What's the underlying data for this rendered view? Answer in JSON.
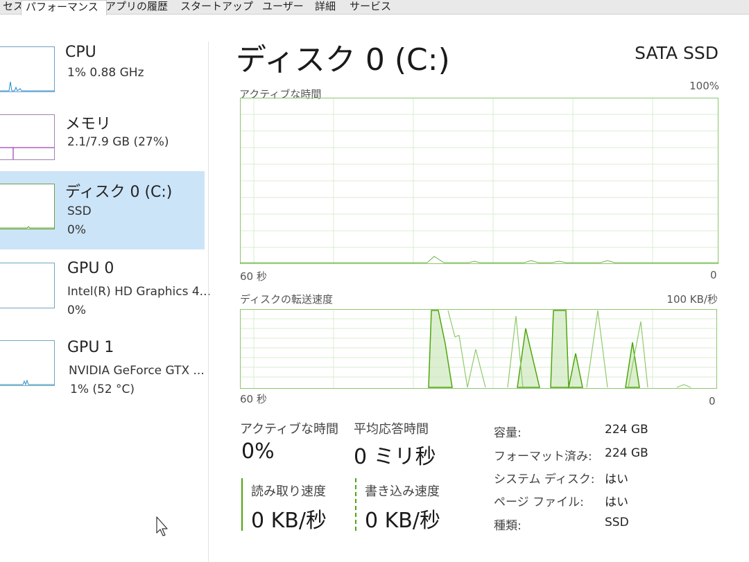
{
  "tabs": [
    {
      "label": "セス"
    },
    {
      "label": "パフォーマンス",
      "active": true
    },
    {
      "label": "アプリの履歴"
    },
    {
      "label": "スタートアップ"
    },
    {
      "label": "ユーザー"
    },
    {
      "label": "詳細"
    },
    {
      "label": "サービス"
    }
  ],
  "sidebar": {
    "items": [
      {
        "title": "CPU",
        "line1": "1% 0.88 GHz",
        "line2": ""
      },
      {
        "title": "メモリ",
        "line1": "2.1/7.9 GB (27%)",
        "line2": ""
      },
      {
        "title": "ディスク 0 (C:)",
        "line1": "SSD",
        "line2": "0%",
        "selected": true
      },
      {
        "title": "GPU 0",
        "line1": "Intel(R) HD Graphics 4...",
        "line2": "0%"
      },
      {
        "title": "GPU 1",
        "line1": "NVIDIA GeForce GTX ...",
        "line2": "1% (52 °C)"
      }
    ]
  },
  "main": {
    "title": "ディスク 0 (C:)",
    "disk_type": "SATA SSD",
    "active_chart": {
      "label": "アクティブな時間",
      "max_label": "100%",
      "time_label": "60 秒",
      "min_label": "0"
    },
    "transfer_chart": {
      "label": "ディスクの転送速度",
      "max_label": "100 KB/秒",
      "time_label": "60 秒",
      "min_label": "0"
    }
  },
  "stats": {
    "active_time": {
      "label": "アクティブな時間",
      "value": "0%"
    },
    "avg_response": {
      "label": "平均応答時間",
      "value": "0 ミリ秒"
    },
    "read_speed": {
      "label": "読み取り速度",
      "value": "0 KB/秒"
    },
    "write_speed": {
      "label": "書き込み速度",
      "value": "0 KB/秒"
    }
  },
  "properties": [
    {
      "key": "容量:",
      "value": "224 GB"
    },
    {
      "key": "フォーマット済み:",
      "value": "224 GB"
    },
    {
      "key": "システム ディスク:",
      "value": "はい"
    },
    {
      "key": "ページ ファイル:",
      "value": "はい"
    },
    {
      "key": "種類:",
      "value": "SSD"
    }
  ],
  "colors": {
    "disk_green": "#4da60c",
    "grid": "#d9ecd0",
    "selected_bg": "#cce4f7",
    "cpu_blue": "#1b8ad6",
    "memory_purple": "#8b12ae",
    "gpu_teal": "#2a8fb5"
  },
  "icons": {
    "cursor": "mouse-pointer-icon"
  }
}
